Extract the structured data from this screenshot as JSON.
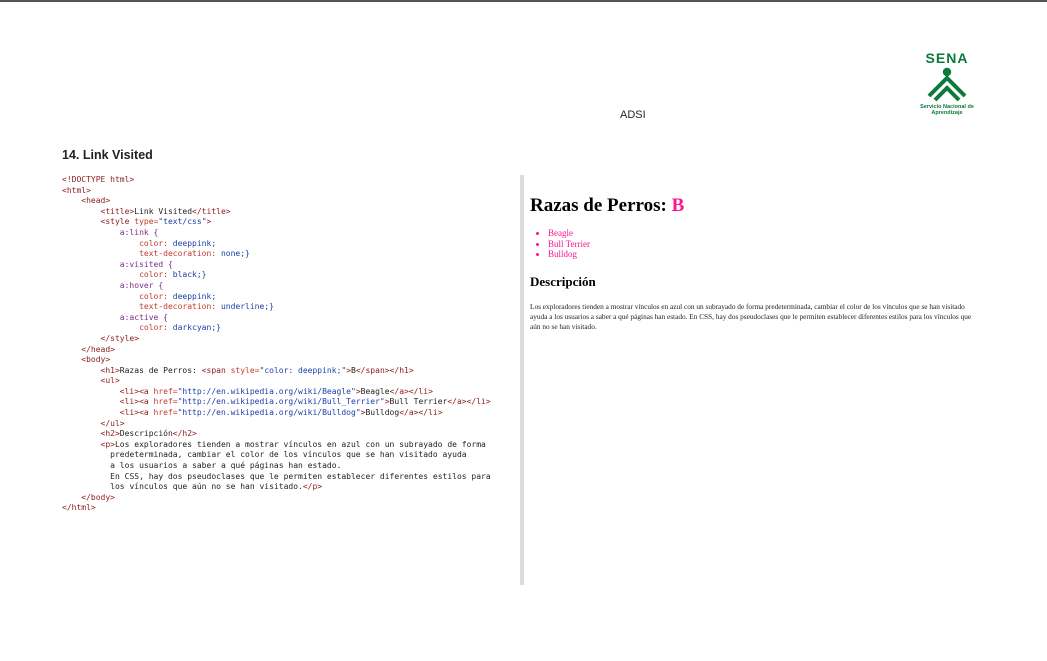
{
  "header": {
    "logo_word": "SENA",
    "logo_sub": "Servicio Nacional de Aprendizaje",
    "program": "ADSI"
  },
  "section_title": "14. Link Visited",
  "code_lines": [
    {
      "indent": "",
      "parts": [
        {
          "c": "tag",
          "t": "<!DOCTYPE html>"
        }
      ]
    },
    {
      "indent": "",
      "parts": [
        {
          "c": "tag",
          "t": "<html>"
        }
      ]
    },
    {
      "indent": "    ",
      "parts": [
        {
          "c": "tag",
          "t": "<head>"
        }
      ]
    },
    {
      "indent": "        ",
      "parts": [
        {
          "c": "tag",
          "t": "<title>"
        },
        {
          "c": "txt",
          "t": "Link Visited"
        },
        {
          "c": "tag",
          "t": "</title>"
        }
      ]
    },
    {
      "indent": "        ",
      "parts": [
        {
          "c": "tag",
          "t": "<style "
        },
        {
          "c": "attr",
          "t": "type="
        },
        {
          "c": "str",
          "t": "\"text/css\""
        },
        {
          "c": "tag",
          "t": ">"
        }
      ]
    },
    {
      "indent": "            ",
      "parts": [
        {
          "c": "sel",
          "t": "a:link {"
        }
      ]
    },
    {
      "indent": "                ",
      "parts": [
        {
          "c": "prop",
          "t": "color: "
        },
        {
          "c": "val",
          "t": "deeppink;"
        }
      ]
    },
    {
      "indent": "                ",
      "parts": [
        {
          "c": "prop",
          "t": "text-decoration: "
        },
        {
          "c": "val",
          "t": "none;}"
        }
      ]
    },
    {
      "indent": "            ",
      "parts": [
        {
          "c": "sel",
          "t": "a:visited {"
        }
      ]
    },
    {
      "indent": "                ",
      "parts": [
        {
          "c": "prop",
          "t": "color: "
        },
        {
          "c": "val",
          "t": "black;}"
        }
      ]
    },
    {
      "indent": "            ",
      "parts": [
        {
          "c": "sel",
          "t": "a:hover {"
        }
      ]
    },
    {
      "indent": "                ",
      "parts": [
        {
          "c": "prop",
          "t": "color: "
        },
        {
          "c": "val",
          "t": "deeppink;"
        }
      ]
    },
    {
      "indent": "                ",
      "parts": [
        {
          "c": "prop",
          "t": "text-decoration: "
        },
        {
          "c": "val",
          "t": "underline;}"
        }
      ]
    },
    {
      "indent": "            ",
      "parts": [
        {
          "c": "sel",
          "t": "a:active {"
        }
      ]
    },
    {
      "indent": "                ",
      "parts": [
        {
          "c": "prop",
          "t": "color: "
        },
        {
          "c": "val",
          "t": "darkcyan;}"
        }
      ]
    },
    {
      "indent": "        ",
      "parts": [
        {
          "c": "tag",
          "t": "</style>"
        }
      ]
    },
    {
      "indent": "    ",
      "parts": [
        {
          "c": "tag",
          "t": "</head>"
        }
      ]
    },
    {
      "indent": "    ",
      "parts": [
        {
          "c": "tag",
          "t": "<body>"
        }
      ]
    },
    {
      "indent": "        ",
      "parts": [
        {
          "c": "tag",
          "t": "<h1>"
        },
        {
          "c": "txt",
          "t": "Razas de Perros: "
        },
        {
          "c": "tag",
          "t": "<span "
        },
        {
          "c": "attr",
          "t": "style="
        },
        {
          "c": "str",
          "t": "\"color: deeppink;\""
        },
        {
          "c": "tag",
          "t": ">"
        },
        {
          "c": "txt",
          "t": "B"
        },
        {
          "c": "tag",
          "t": "</span></h1>"
        }
      ]
    },
    {
      "indent": "        ",
      "parts": [
        {
          "c": "tag",
          "t": "<ul>"
        }
      ]
    },
    {
      "indent": "            ",
      "parts": [
        {
          "c": "tag",
          "t": "<li><a "
        },
        {
          "c": "attr",
          "t": "href="
        },
        {
          "c": "str",
          "t": "\"http://en.wikipedia.org/wiki/Beagle\""
        },
        {
          "c": "tag",
          "t": ">"
        },
        {
          "c": "txt",
          "t": "Beagle"
        },
        {
          "c": "tag",
          "t": "</a></li>"
        }
      ]
    },
    {
      "indent": "            ",
      "parts": [
        {
          "c": "tag",
          "t": "<li><a "
        },
        {
          "c": "attr",
          "t": "href="
        },
        {
          "c": "str",
          "t": "\"http://en.wikipedia.org/wiki/Bull_Terrier\""
        },
        {
          "c": "tag",
          "t": ">"
        },
        {
          "c": "txt",
          "t": "Bull Terrier"
        },
        {
          "c": "tag",
          "t": "</a></li>"
        }
      ]
    },
    {
      "indent": "            ",
      "parts": [
        {
          "c": "tag",
          "t": "<li><a "
        },
        {
          "c": "attr",
          "t": "href="
        },
        {
          "c": "str",
          "t": "\"http://en.wikipedia.org/wiki/Bulldog\""
        },
        {
          "c": "tag",
          "t": ">"
        },
        {
          "c": "txt",
          "t": "Bulldog"
        },
        {
          "c": "tag",
          "t": "</a></li>"
        }
      ]
    },
    {
      "indent": "        ",
      "parts": [
        {
          "c": "tag",
          "t": "</ul>"
        }
      ]
    },
    {
      "indent": "        ",
      "parts": [
        {
          "c": "tag",
          "t": "<h2>"
        },
        {
          "c": "txt",
          "t": "Descripción"
        },
        {
          "c": "tag",
          "t": "</h2>"
        }
      ]
    },
    {
      "indent": "        ",
      "parts": [
        {
          "c": "tag",
          "t": "<p>"
        },
        {
          "c": "txt",
          "t": "Los exploradores tienden a mostrar vínculos en azul con un subrayado de forma"
        }
      ]
    },
    {
      "indent": "          ",
      "parts": [
        {
          "c": "txt",
          "t": "predeterminada, cambiar el color de los vínculos que se han visitado ayuda"
        }
      ]
    },
    {
      "indent": "          ",
      "parts": [
        {
          "c": "txt",
          "t": "a los usuarios a saber a qué páginas han estado."
        }
      ]
    },
    {
      "indent": "          ",
      "parts": [
        {
          "c": "txt",
          "t": "En CSS, hay dos pseudoclases que le permiten establecer diferentes estilos para"
        }
      ]
    },
    {
      "indent": "          ",
      "parts": [
        {
          "c": "txt",
          "t": "los vínculos que aún no se han visitado."
        },
        {
          "c": "tag",
          "t": "</p>"
        }
      ]
    },
    {
      "indent": "    ",
      "parts": [
        {
          "c": "tag",
          "t": "</body>"
        }
      ]
    },
    {
      "indent": "",
      "parts": [
        {
          "c": "tag",
          "t": "</html>"
        }
      ]
    }
  ],
  "preview": {
    "h1_text": "Razas de Perros: ",
    "h1_highlight": "B",
    "links": [
      "Beagle",
      "Bull Terrier",
      "Bulldog"
    ],
    "h2": "Descripción",
    "paragraph": "Los exploradores tienden a mostrar vínculos en azul con un subrayado de forma predeterminada, cambiar el color de los vínculos que se han visitado ayuda a los usuarios a saber a qué páginas han estado. En CSS, hay dos pseudoclases que le permiten establecer diferentes estilos para los vínculos que aún no se han visitado."
  },
  "colors": {
    "link": "#ff1493",
    "brand": "#0b7a3a"
  }
}
